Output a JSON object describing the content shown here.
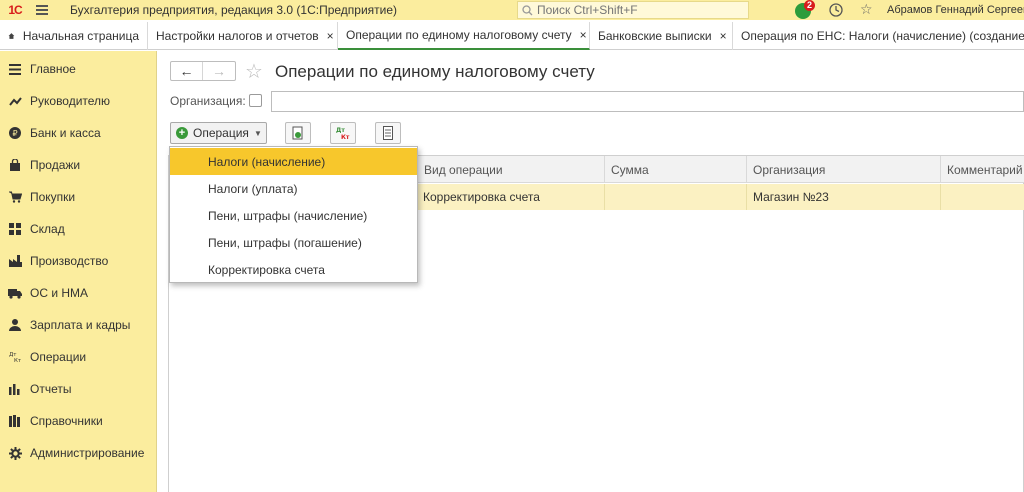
{
  "titlebar": {
    "logo": "1С",
    "app_title": "Бухгалтерия предприятия, редакция 3.0  (1С:Предприятие)",
    "search_placeholder": "Поиск Ctrl+Shift+F",
    "notification_count": "2",
    "user_name": "Абрамов Геннадий Сергеевич"
  },
  "tabs": {
    "home": "Начальная страница",
    "items": [
      {
        "label": "Настройки налогов и отчетов"
      },
      {
        "label": "Операции по единому налоговому счету"
      },
      {
        "label": "Банковские выписки"
      },
      {
        "label": "Операция по ЕНС: Налоги (начисление) (создание)"
      }
    ],
    "close_glyph": "×"
  },
  "sidebar": {
    "items": [
      {
        "label": "Главное",
        "icon": "menu-lines-icon"
      },
      {
        "label": "Руководителю",
        "icon": "trend-icon"
      },
      {
        "label": "Банк и касса",
        "icon": "coin-icon"
      },
      {
        "label": "Продажи",
        "icon": "bag-icon"
      },
      {
        "label": "Покупки",
        "icon": "cart-icon"
      },
      {
        "label": "Склад",
        "icon": "warehouse-icon"
      },
      {
        "label": "Производство",
        "icon": "factory-icon"
      },
      {
        "label": "ОС и НМА",
        "icon": "truck-icon"
      },
      {
        "label": "Зарплата и кадры",
        "icon": "person-icon"
      },
      {
        "label": "Операции",
        "icon": "dt-kt-icon"
      },
      {
        "label": "Отчеты",
        "icon": "bar-chart-icon"
      },
      {
        "label": "Справочники",
        "icon": "books-icon"
      },
      {
        "label": "Администрирование",
        "icon": "gear-icon"
      }
    ]
  },
  "main": {
    "title": "Операции по единому налоговому счету",
    "organization_label": "Организация:",
    "organization_value": "",
    "operation_button": "Операция",
    "table": {
      "columns": [
        "Вид операции",
        "Сумма",
        "Организация",
        "Комментарий"
      ],
      "rows": [
        {
          "operation_type": "Корректировка счета",
          "amount": "",
          "organization": "Магазин №23",
          "comment": ""
        }
      ]
    }
  },
  "dropdown": {
    "items": [
      {
        "label": "Налоги (начисление)",
        "selected": true
      },
      {
        "label": "Налоги (уплата)",
        "selected": false
      },
      {
        "label": "Пени, штрафы (начисление)",
        "selected": false
      },
      {
        "label": "Пени, штрафы (погашение)",
        "selected": false
      },
      {
        "label": "Корректировка счета",
        "selected": false
      }
    ]
  },
  "colors": {
    "sidebar_bg": "#fbed9e",
    "selected_menu": "#f7c72c",
    "row_highlight": "#fbf1c2",
    "logo_red": "#d81c1c",
    "active_green": "#3a8f3a"
  }
}
